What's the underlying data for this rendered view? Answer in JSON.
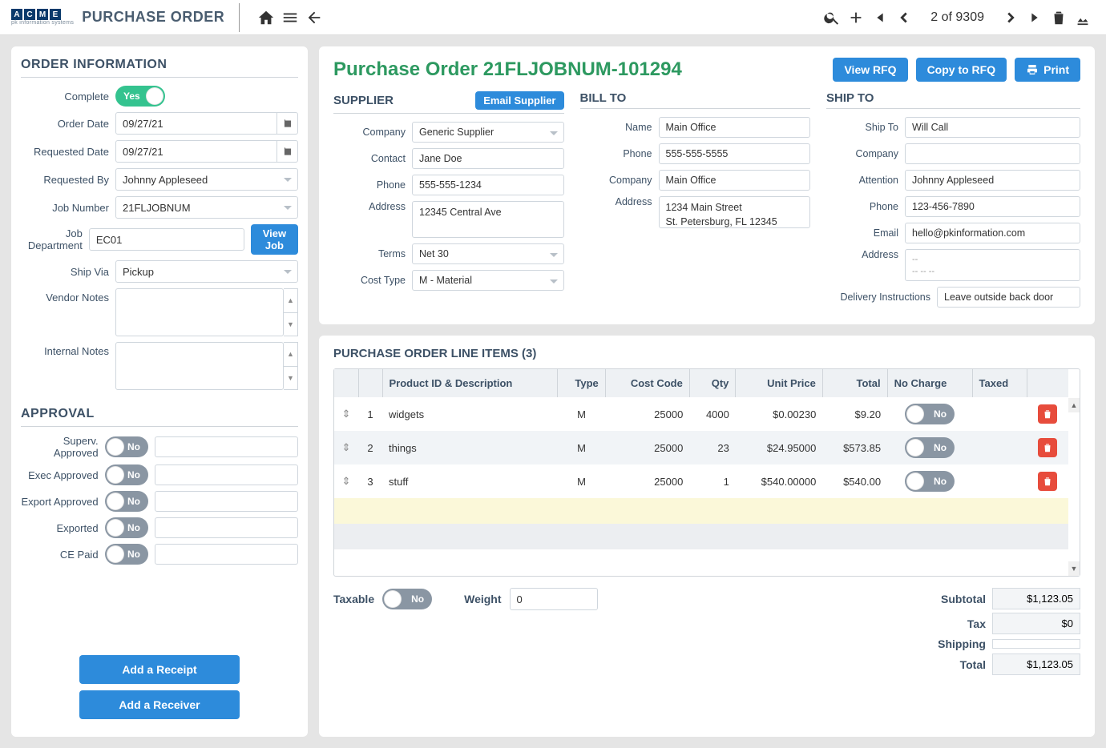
{
  "header": {
    "brand_letters": [
      "A",
      "C",
      "M",
      "E"
    ],
    "brand_sub": "pk information systems",
    "title": "PURCHASE ORDER",
    "pager": "2 of 9309"
  },
  "sidebar": {
    "order_info_title": "ORDER INFORMATION",
    "complete_label": "Complete",
    "complete_toggle": "Yes",
    "order_date_label": "Order Date",
    "order_date": "09/27/21",
    "requested_date_label": "Requested Date",
    "requested_date": "09/27/21",
    "requested_by_label": "Requested By",
    "requested_by": "Johnny Appleseed",
    "job_number_label": "Job Number",
    "job_number": "21FLJOBNUM",
    "job_dept_label": "Job Department",
    "job_dept": "EC01",
    "view_job_btn": "View Job",
    "ship_via_label": "Ship Via",
    "ship_via": "Pickup",
    "vendor_notes_label": "Vendor Notes",
    "internal_notes_label": "Internal Notes",
    "approval_title": "APPROVAL",
    "approvals": [
      {
        "label": "Superv. Approved",
        "toggle": "No"
      },
      {
        "label": "Exec Approved",
        "toggle": "No"
      },
      {
        "label": "Export Approved",
        "toggle": "No"
      },
      {
        "label": "Exported",
        "toggle": "No"
      },
      {
        "label": "CE Paid",
        "toggle": "No"
      }
    ],
    "add_receipt_btn": "Add a Receipt",
    "add_receiver_btn": "Add a Receiver"
  },
  "main": {
    "po_title": "Purchase Order 21FLJOBNUM-101294",
    "view_rfq_btn": "View RFQ",
    "copy_rfq_btn": "Copy to RFQ",
    "print_btn": "Print",
    "email_supplier_btn": "Email Supplier",
    "supplier": {
      "title": "SUPPLIER",
      "company_label": "Company",
      "company": "Generic Supplier",
      "contact_label": "Contact",
      "contact": "Jane Doe",
      "phone_label": "Phone",
      "phone": "555-555-1234",
      "address_label": "Address",
      "address": "12345 Central Ave",
      "terms_label": "Terms",
      "terms": "Net 30",
      "cost_type_label": "Cost Type",
      "cost_type": "M - Material"
    },
    "billto": {
      "title": "BILL TO",
      "name_label": "Name",
      "name": "Main Office",
      "phone_label": "Phone",
      "phone": "555-555-5555",
      "company_label": "Company",
      "company": "Main Office",
      "address_label": "Address",
      "address": "1234 Main Street\nSt. Petersburg,  FL 12345"
    },
    "shipto": {
      "title": "SHIP TO",
      "shipto_label": "Ship To",
      "shipto": "Will Call",
      "company_label": "Company",
      "company": "",
      "attention_label": "Attention",
      "attention": "Johnny Appleseed",
      "phone_label": "Phone",
      "phone": "123-456-7890",
      "email_label": "Email",
      "email": "hello@pkinformation.com",
      "address_label": "Address",
      "address": "--\n--  -- --",
      "delivery_label": "Delivery Instructions",
      "delivery": "Leave outside back door"
    }
  },
  "lineitems": {
    "title": "PURCHASE ORDER LINE ITEMS (3)",
    "columns": [
      "",
      "",
      "Product ID & Description",
      "Type",
      "Cost Code",
      "Qty",
      "Unit Price",
      "Total",
      "No Charge",
      "Taxed",
      ""
    ],
    "rows": [
      {
        "idx": "1",
        "desc": "widgets",
        "type": "M",
        "cost": "25000",
        "qty": "4000",
        "price": "$0.00230",
        "total": "$9.20",
        "nocharge": "No"
      },
      {
        "idx": "2",
        "desc": "things",
        "type": "M",
        "cost": "25000",
        "qty": "23",
        "price": "$24.95000",
        "total": "$573.85",
        "nocharge": "No"
      },
      {
        "idx": "3",
        "desc": "stuff",
        "type": "M",
        "cost": "25000",
        "qty": "1",
        "price": "$540.00000",
        "total": "$540.00",
        "nocharge": "No"
      }
    ],
    "taxable_label": "Taxable",
    "taxable_toggle": "No",
    "weight_label": "Weight",
    "weight": "0",
    "subtotal_label": "Subtotal",
    "subtotal": "$1,123.05",
    "tax_label": "Tax",
    "tax": "$0",
    "shipping_label": "Shipping",
    "shipping": "",
    "total_label": "Total",
    "total": "$1,123.05"
  }
}
